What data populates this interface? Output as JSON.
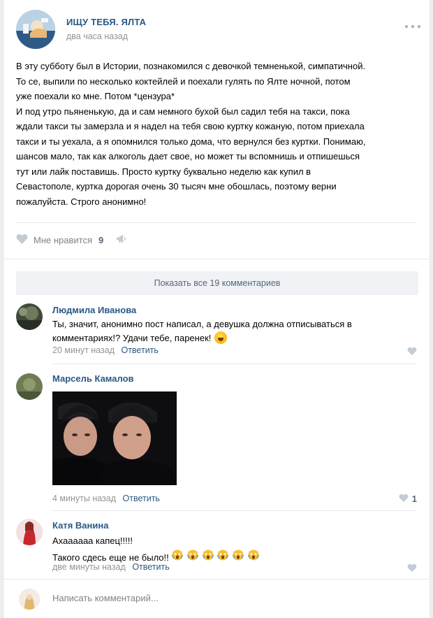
{
  "post": {
    "group_name": "ИЩУ ТЕБЯ. ЯЛТА",
    "date": "два часа назад",
    "text": "В эту субботу был в Истории, познакомился с девочкой темненькой, симпатичной.\nТо се, выпили по несколько коктейлей и поехали гулять по Ялте ночной, потом\nуже поехали ко мне. Потом *цензура*\nИ под утро пьяненькую, да и сам немного бухой был садил тебя на такси, пока\nждали такси ты замерзла и я надел на тебя свою куртку кожаную, потом приехала\nтакси и ты уехала, а я опомнился только дома, что вернулся без куртки. Понимаю,\nшансов мало, так как алкоголь дает свое, но может ты вспомнишь и отпишешься\nтут или лайк поставишь. Просто куртку буквально неделю как купил в\nСевастополе, куртка дорогая очень 30 тысяч мне обошлась, поэтому верни\nпожалуйста. Строго анонимно!",
    "like_label": "Мне нравится",
    "like_count": "9"
  },
  "show_all_comments": "Показать все 19 комментариев",
  "comments": [
    {
      "author": "Людмила Иванова",
      "text": "Ты, значит, анонимно пост написал, а девушка должна отписываться в\nкомментариях!? Удачи тебе, паренек!",
      "time": "20 минут назад",
      "reply": "Ответить",
      "likes": ""
    },
    {
      "author": "Марсель Камалов",
      "text": "",
      "time": "4 минуты назад",
      "reply": "Ответить",
      "likes": "1"
    },
    {
      "author": "Катя Ванина",
      "text_line1": "Ахаааааа капец!!!!!",
      "text_line2": "Такого сдесь еще не было!!",
      "time": "две минуты назад",
      "reply": "Ответить",
      "likes": ""
    }
  ],
  "composer": {
    "placeholder": "Написать комментарий..."
  },
  "icons": {
    "like": "heart-icon",
    "share": "megaphone-icon",
    "more": "more-dots-icon",
    "emoji_laugh": "laughing-emoji-icon",
    "emoji_scream": "scream-cat-emoji-icon"
  },
  "colors": {
    "link": "#2a5885",
    "muted": "#939393",
    "icon": "#c3cbd4",
    "band": "#f0f2f5"
  }
}
